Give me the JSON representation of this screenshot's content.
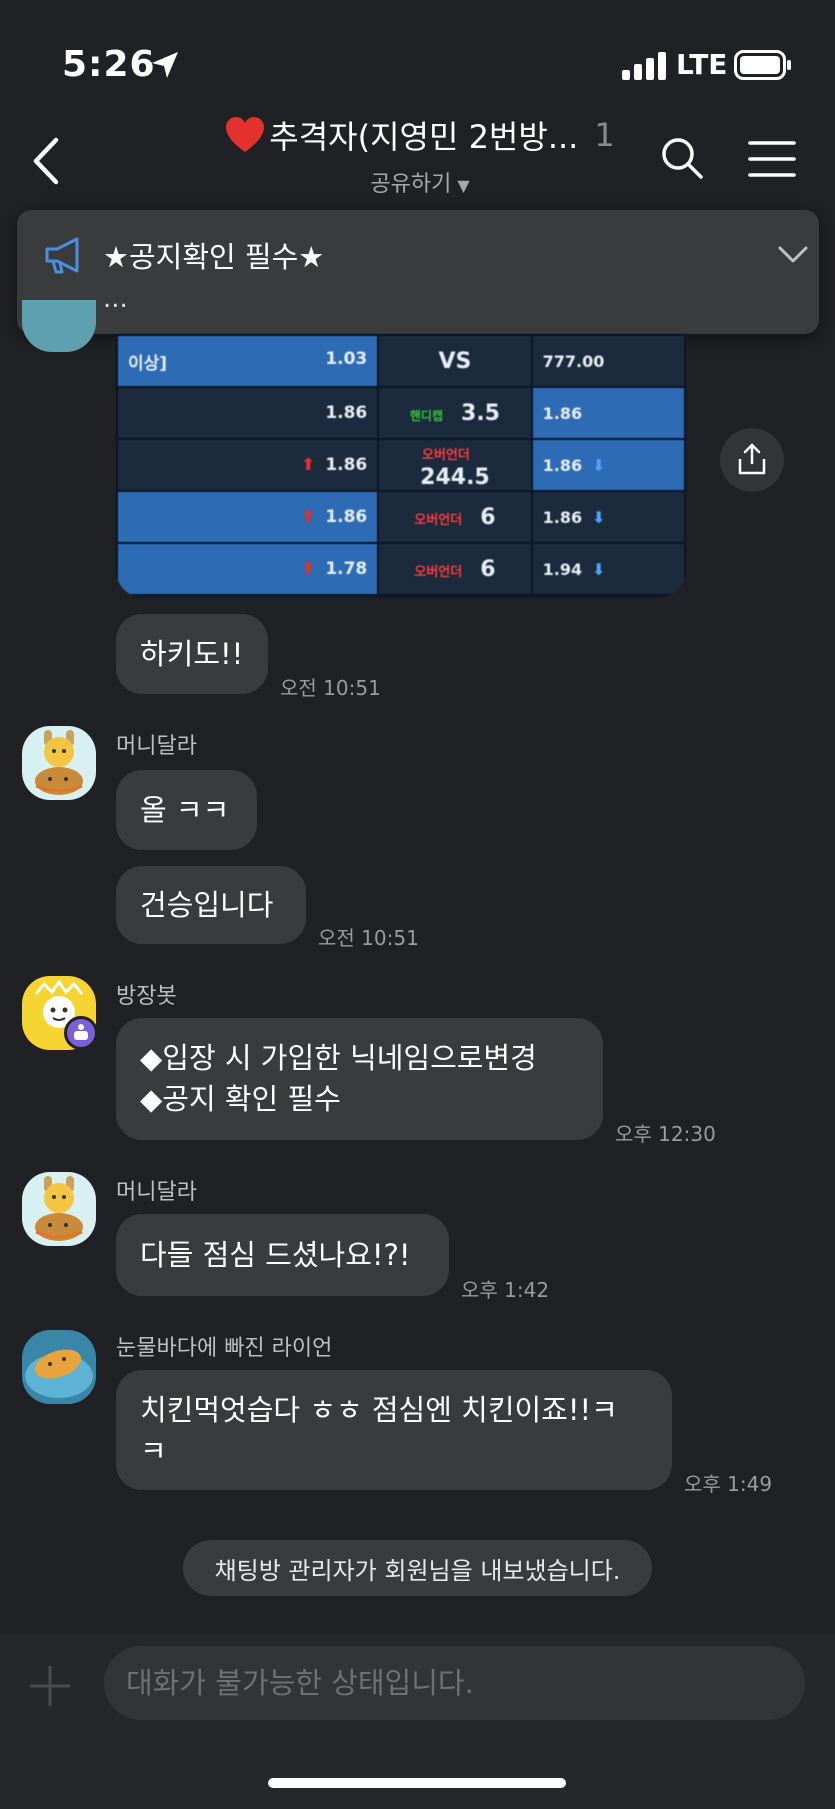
{
  "status_bar": {
    "time": "5:26",
    "network": "LTE"
  },
  "header": {
    "room_name": "추격자(지영민 2번방...",
    "member_count": "1",
    "share_label": "공유하기"
  },
  "notice": {
    "title": "★공지확인 필수★",
    "preview": "..."
  },
  "image_message": {
    "rows": [
      [
        "이상]",
        "1.03",
        "VS",
        "777.00"
      ],
      [
        "",
        "1.86",
        "3.5",
        "1.86"
      ],
      [
        "",
        "1.86",
        "244.5",
        "1.86"
      ],
      [
        "",
        "1.86",
        "6",
        "1.86"
      ],
      [
        "",
        "1.78",
        "6",
        "1.94"
      ]
    ],
    "handicap_label": "핸디캡",
    "overunder_label": "오버언더"
  },
  "messages": [
    {
      "sender": "",
      "text": "하키도!!",
      "time": "오전 10:51"
    },
    {
      "sender": "머니달라",
      "text": "올 ㅋㅋ",
      "time": ""
    },
    {
      "sender": "",
      "text": "건승입니다",
      "time": "오전 10:51"
    },
    {
      "sender": "방장봇",
      "line1": "◆입장 시 가입한 닉네임으로변경",
      "line2": "◆공지 확인 필수",
      "time": "오후 12:30"
    },
    {
      "sender": "머니달라",
      "text": "다들 점심 드셨나요!?!",
      "time": "오후 1:42"
    },
    {
      "sender": "눈물바다에 빠진 라이언",
      "line1": "치킨먹엇습다 ㅎㅎ 점심엔 치킨이죠!!ㅋ",
      "line2": "ㅋ",
      "time": "오후 1:49"
    }
  ],
  "system_message": "채팅방 관리자가 회원님을 내보냈습니다.",
  "input": {
    "placeholder": "대화가 불가능한 상태입니다."
  },
  "colors": {
    "background": "#202124",
    "bubble": "#3a3b3d",
    "accent_blue": "#4a8fe0"
  }
}
